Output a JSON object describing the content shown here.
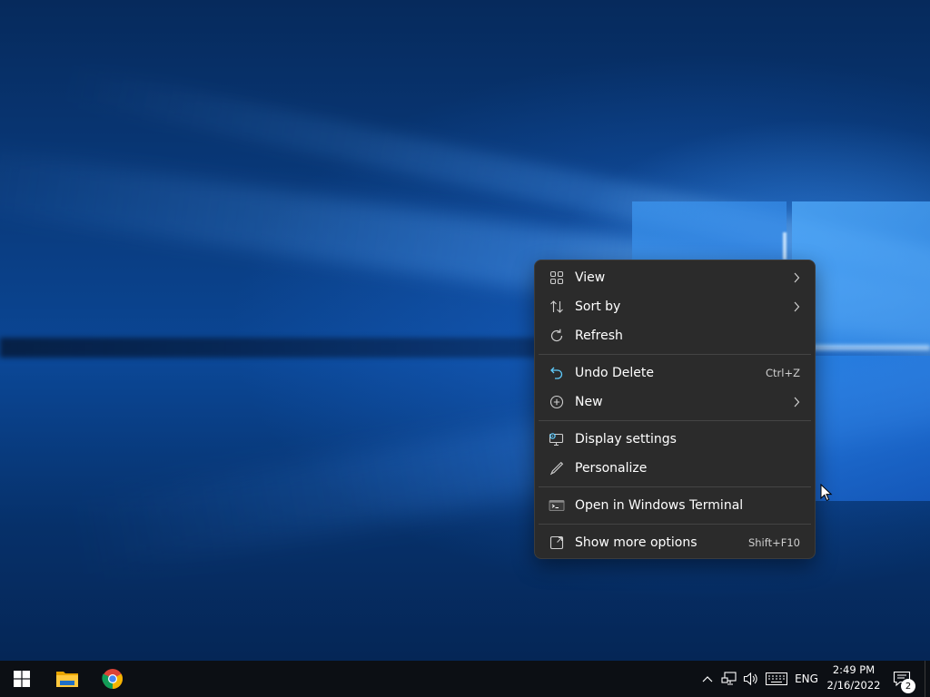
{
  "context_menu": {
    "items": [
      {
        "label": "View",
        "icon": "view-grid-icon",
        "shortcut": "",
        "submenu": true
      },
      {
        "label": "Sort by",
        "icon": "sort-icon",
        "shortcut": "",
        "submenu": true
      },
      {
        "label": "Refresh",
        "icon": "refresh-icon",
        "shortcut": "",
        "submenu": false
      },
      {
        "label": "Undo Delete",
        "icon": "undo-icon",
        "shortcut": "Ctrl+Z",
        "submenu": false
      },
      {
        "label": "New",
        "icon": "new-plus-icon",
        "shortcut": "",
        "submenu": true
      },
      {
        "label": "Display settings",
        "icon": "display-settings-icon",
        "shortcut": "",
        "submenu": false
      },
      {
        "label": "Personalize",
        "icon": "personalize-pen-icon",
        "shortcut": "",
        "submenu": false
      },
      {
        "label": "Open in Windows Terminal",
        "icon": "terminal-icon",
        "shortcut": "",
        "submenu": false
      },
      {
        "label": "Show more options",
        "icon": "show-more-options-icon",
        "shortcut": "Shift+F10",
        "submenu": false
      }
    ]
  },
  "taskbar": {
    "pinned": [
      {
        "name": "Start",
        "icon": "windows-start-icon"
      },
      {
        "name": "File Explorer",
        "icon": "file-explorer-icon"
      },
      {
        "name": "Google Chrome",
        "icon": "chrome-icon"
      }
    ],
    "tray": {
      "language": "ENG",
      "time": "2:49 PM",
      "date": "2/16/2022",
      "notification_count": "2"
    }
  },
  "colors": {
    "menu_bg": "#2b2b2b",
    "taskbar_bg": "#0c0f14",
    "accent": "#60cdff"
  }
}
